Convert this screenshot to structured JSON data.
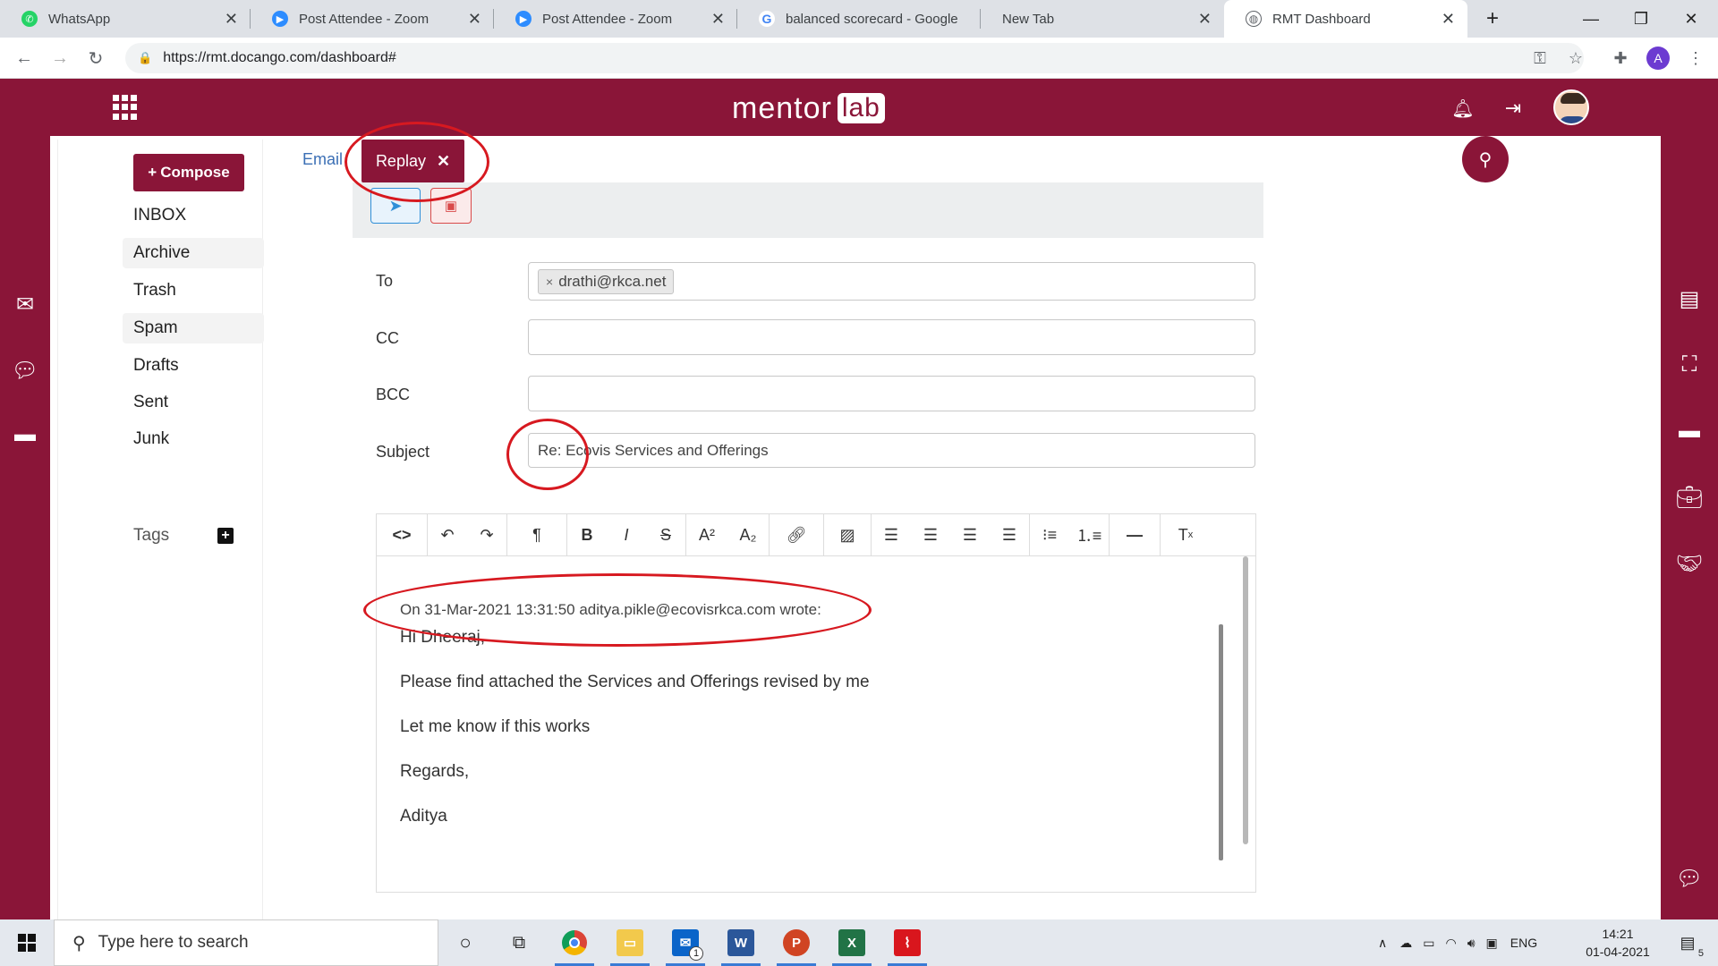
{
  "browser": {
    "tabs": [
      {
        "title": "WhatsApp",
        "favicon": "whatsapp-icon",
        "color": "#25d366"
      },
      {
        "title": "Post Attendee - Zoom",
        "favicon": "zoom-icon",
        "color": "#2d8cff"
      },
      {
        "title": "Post Attendee - Zoom",
        "favicon": "zoom-icon",
        "color": "#2d8cff"
      },
      {
        "title": "balanced scorecard - Google",
        "favicon": "google-icon",
        "color": "#4285f4"
      },
      {
        "title": "New Tab",
        "favicon": "",
        "color": ""
      },
      {
        "title": "RMT Dashboard",
        "favicon": "globe-icon",
        "color": "#5f6368"
      }
    ],
    "new_tab": "+",
    "url": "https://rmt.docango.com/dashboard#",
    "profile_letter": "A"
  },
  "header": {
    "logo_text": "mentor",
    "logo_box": "lab",
    "brand_color": "#8a1538"
  },
  "sidebar": {
    "compose_label": "Compose",
    "folders": [
      {
        "label": "INBOX",
        "shaded": false
      },
      {
        "label": "Archive",
        "shaded": true
      },
      {
        "label": "Trash",
        "shaded": false
      },
      {
        "label": "Spam",
        "shaded": true
      },
      {
        "label": "Drafts",
        "shaded": false
      },
      {
        "label": "Sent",
        "shaded": false
      },
      {
        "label": "Junk",
        "shaded": false
      }
    ],
    "tags_label": "Tags"
  },
  "main": {
    "email_tab": "Email",
    "replay_tab": "Replay",
    "form": {
      "to_label": "To",
      "to_chip": "drathi@rkca.net",
      "cc_label": "CC",
      "cc_value": "",
      "bcc_label": "BCC",
      "bcc_value": "",
      "subject_label": "Subject",
      "subject_value": "Re: Ecovis Services and Offerings"
    },
    "editor": {
      "quote_header": "On 31-Mar-2021 13:31:50 aditya.pikle@ecovisrkca.com wrote:",
      "lines": [
        "Hi Dheeraj,",
        "Please find attached the Services and Offerings revised by me",
        "Let me know if this works",
        "Regards,",
        "Aditya"
      ]
    }
  },
  "taskbar": {
    "search_placeholder": "Type here to search",
    "mail_badge": "1",
    "lang": "ENG",
    "time": "14:21",
    "date": "01-04-2021",
    "notif_count": "5"
  }
}
